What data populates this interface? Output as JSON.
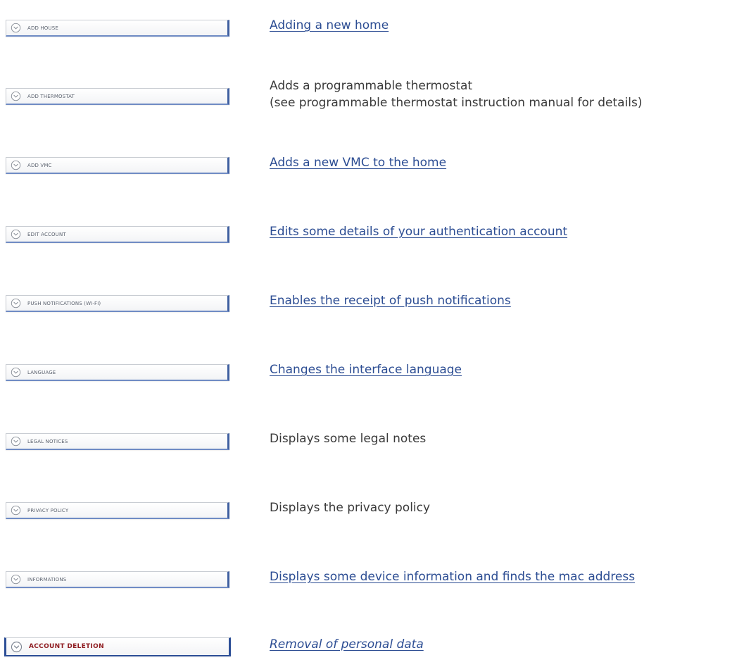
{
  "menu_items": [
    {
      "button_label": "ADD HOUSE",
      "description": "Adding a new home"
    },
    {
      "button_label": "ADD THERMOSTAT",
      "description_lines": [
        "Adds a programmable thermostat",
        "(see programmable thermostat instruction manual for details)"
      ]
    },
    {
      "button_label": "ADD VMC",
      "description": "Adds a new VMC to the home"
    },
    {
      "button_label": "EDIT ACCOUNT",
      "description": "Edits some details of your authentication account"
    },
    {
      "button_label": "PUSH NOTIFICATIONS (WI-FI)",
      "description": "Enables the receipt of push notifications"
    },
    {
      "button_label": "LANGUAGE",
      "description": "Changes the interface language"
    },
    {
      "button_label": "LEGAL NOTICES",
      "description": "Displays some legal notes"
    },
    {
      "button_label": "PRIVACY POLICY",
      "description": "Displays the privacy policy"
    },
    {
      "button_label": "INFORMATIONS",
      "description": "Displays some device information and finds the mac address"
    },
    {
      "button_label": "ACCOUNT DELETION",
      "description": "Removal of personal data"
    }
  ],
  "icons": {
    "button_icon": "chevron-down-circle-icon"
  },
  "colors": {
    "link_blue": "#2c4d93",
    "button_accent_blue": "#3f5fa0",
    "danger_red": "#8f1d22",
    "body_text": "#3a3a3a",
    "button_text": "#5d6470"
  }
}
